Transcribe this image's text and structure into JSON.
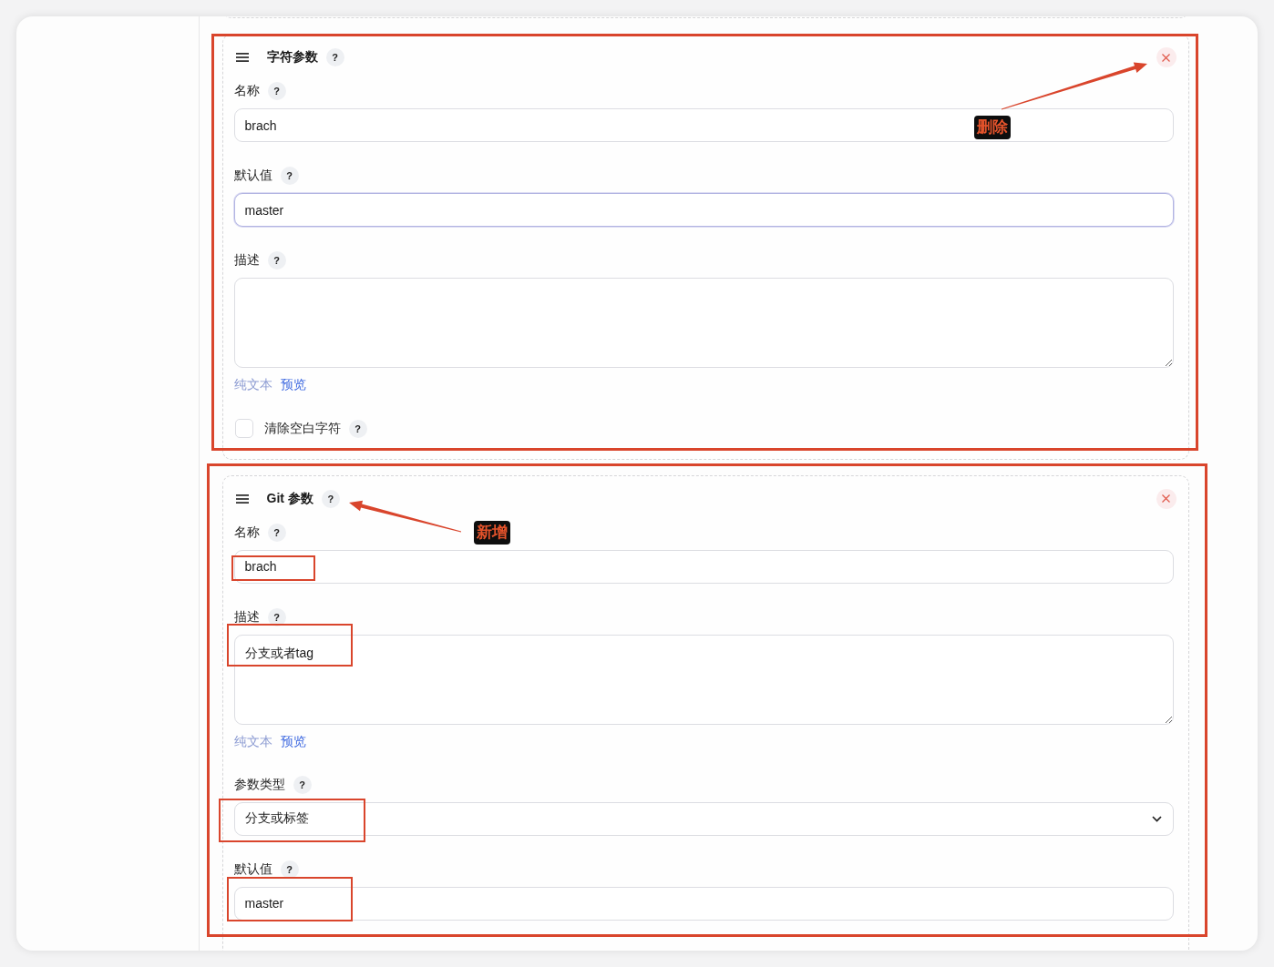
{
  "parameters": [
    {
      "title": "字符参数",
      "help": "?",
      "highlighted": true,
      "callout": "删除",
      "fields": [
        {
          "kind": "input",
          "label": "名称",
          "help": "?",
          "value": "brach",
          "focused": false,
          "highlighted": false
        },
        {
          "kind": "input",
          "label": "默认值",
          "help": "?",
          "value": "master",
          "focused": true,
          "highlighted": false
        },
        {
          "kind": "textarea",
          "label": "描述",
          "help": "?",
          "focused": false,
          "highlighted": false,
          "formatter": "纯文本",
          "preview": "预览"
        },
        {
          "kind": "checkbox",
          "label": "清除空白字符",
          "help": "?",
          "checked": false,
          "highlighted": false
        }
      ]
    },
    {
      "title": "Git 参数",
      "help": "?",
      "highlighted": true,
      "callout": "新增",
      "fields": [
        {
          "kind": "input",
          "label": "名称",
          "help": "?",
          "value": "brach",
          "focused": false,
          "highlighted": true
        },
        {
          "kind": "textarea",
          "label": "描述",
          "help": "?",
          "value": "分支或者tag",
          "focused": false,
          "highlighted": true,
          "formatter": "纯文本",
          "preview": "预览"
        },
        {
          "kind": "select",
          "label": "参数类型",
          "help": "?",
          "value": "分支或标签",
          "highlighted": true
        },
        {
          "kind": "input",
          "label": "默认值",
          "help": "?",
          "value": "master",
          "focused": false,
          "highlighted": true
        }
      ]
    }
  ]
}
